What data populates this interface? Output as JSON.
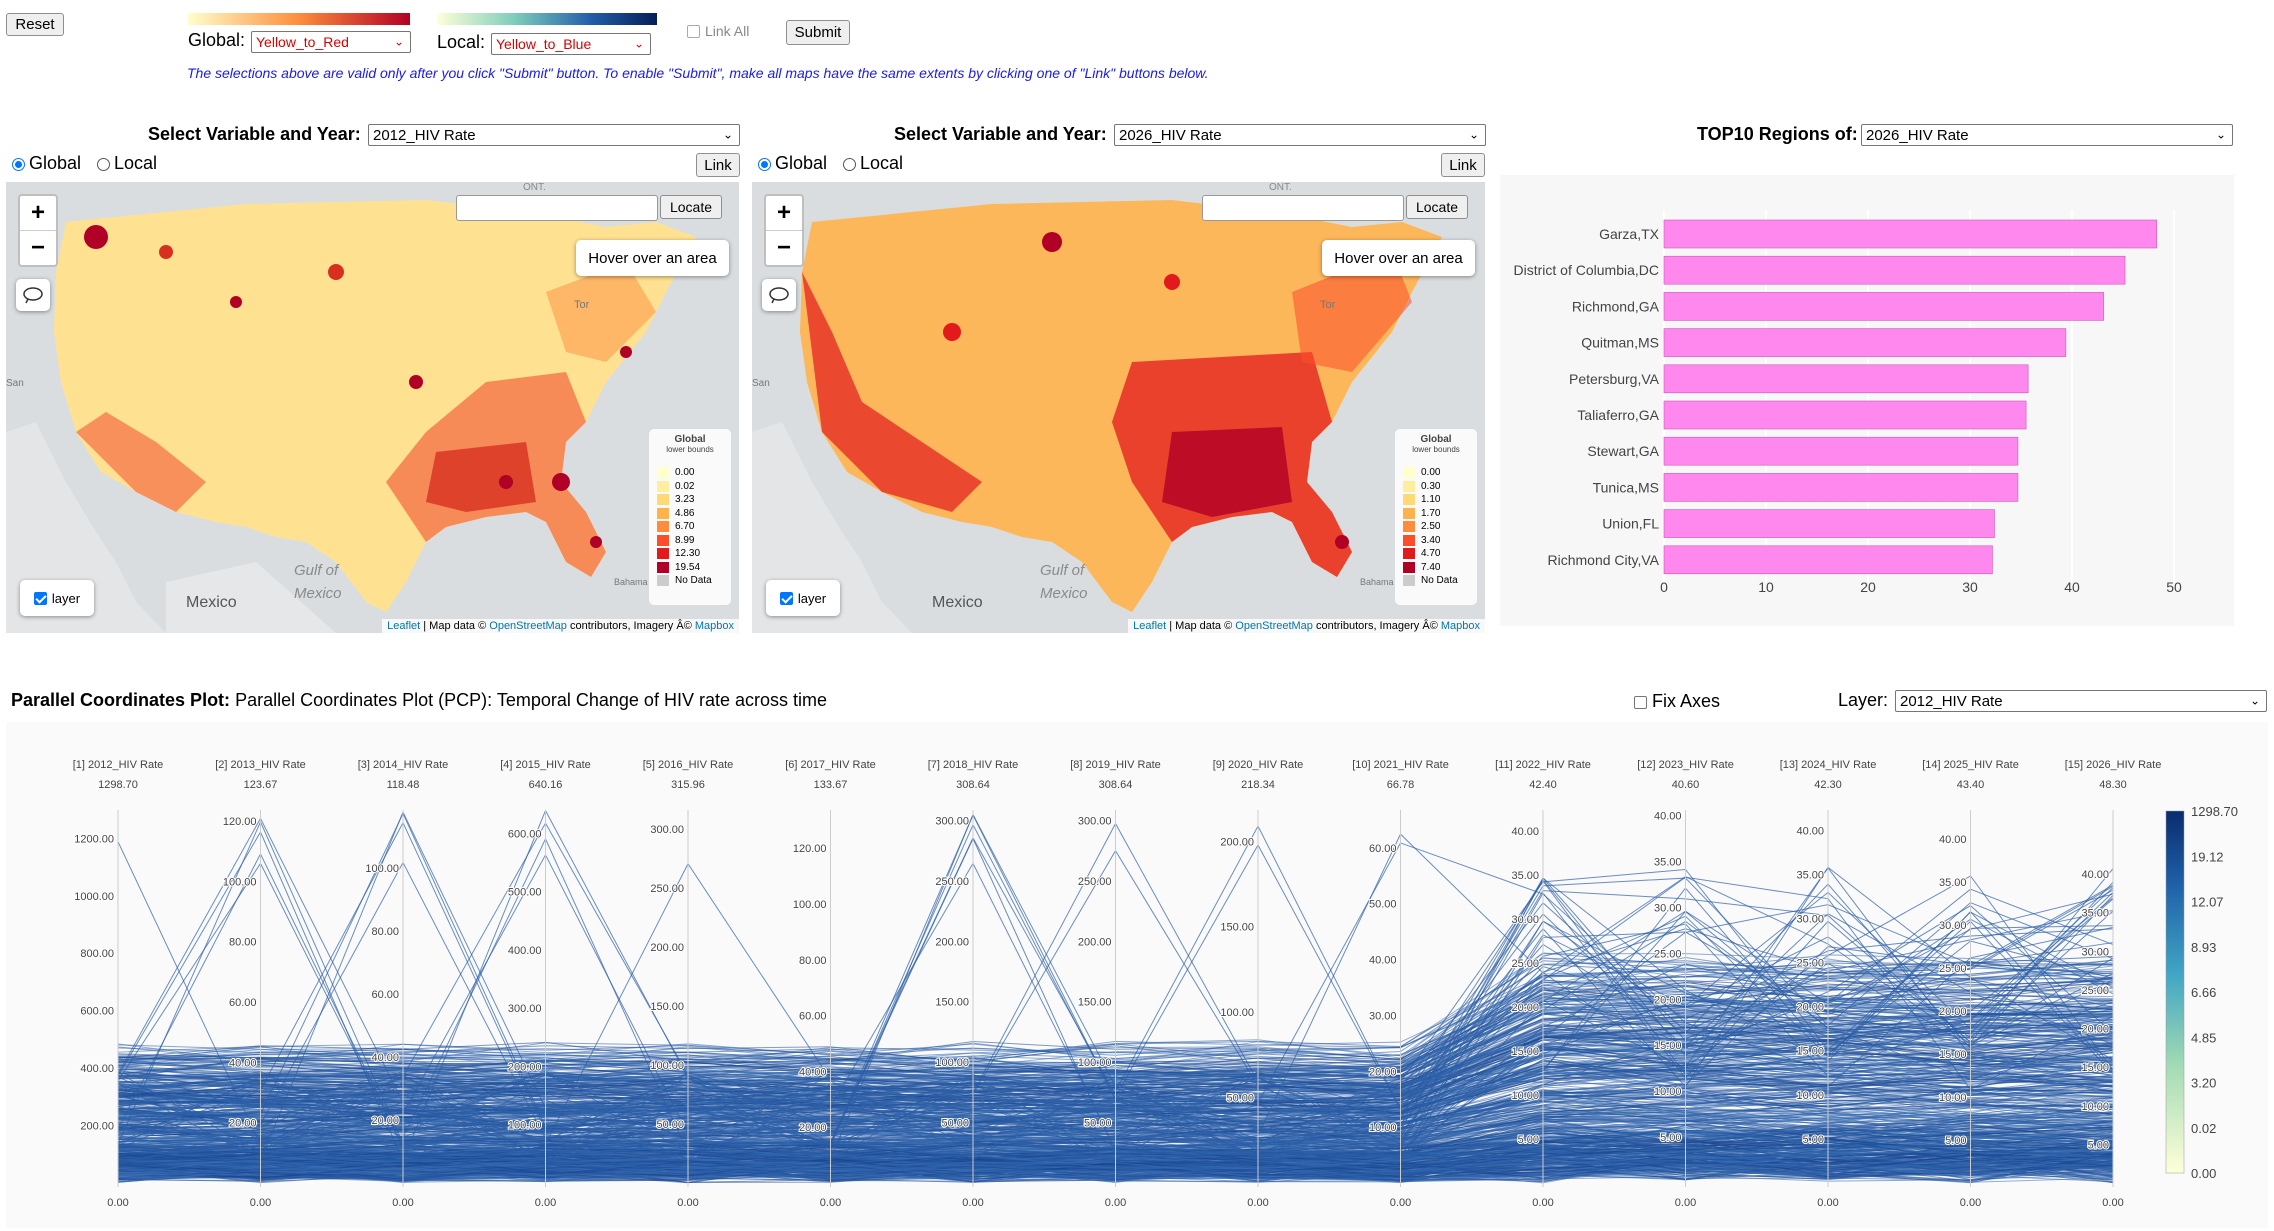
{
  "toolbar": {
    "reset_label": "Reset",
    "global_label": "Global:",
    "global_scheme": "Yellow_to_Red",
    "local_label": "Local:",
    "local_scheme": "Yellow_to_Blue",
    "link_all_label": "Link All",
    "submit_label": "Submit",
    "note": "The selections above are valid only after you click \"Submit\" button. To enable \"Submit\", make all maps have the same extents by clicking one of \"Link\" buttons below."
  },
  "maps": [
    {
      "select_label": "Select Variable and Year:",
      "selected": "2012_HIV Rate",
      "global_label": "Global",
      "local_label": "Local",
      "link_label": "Link",
      "locate_label": "Locate",
      "hover_text": "Hover over an area",
      "layer_label": "layer",
      "legend_title": "Global",
      "legend_subtitle": "lower bounds",
      "legend_values": [
        "0.00",
        "0.02",
        "3.23",
        "4.86",
        "6.70",
        "8.99",
        "12.30",
        "19.54",
        "No Data"
      ],
      "labels": {
        "mexico": "Mexico",
        "gulf1": "Gulf of",
        "gulf2": "Mexico",
        "ont": "ONT.",
        "tor": "Tor",
        "san": "San",
        "bahamas": "Bahama"
      }
    },
    {
      "select_label": "Select Variable and Year:",
      "selected": "2026_HIV Rate",
      "global_label": "Global",
      "local_label": "Local",
      "link_label": "Link",
      "locate_label": "Locate",
      "hover_text": "Hover over an area",
      "layer_label": "layer",
      "legend_title": "Global",
      "legend_subtitle": "lower bounds",
      "legend_values": [
        "0.00",
        "0.30",
        "1.10",
        "1.70",
        "2.50",
        "3.40",
        "4.70",
        "7.40",
        "No Data"
      ],
      "labels": {
        "mexico": "Mexico",
        "gulf1": "Gulf of",
        "gulf2": "Mexico",
        "ont": "ONT.",
        "tor": "Tor",
        "san": "San",
        "bahamas": "Bahama"
      }
    }
  ],
  "attribution": {
    "leaflet": "Leaflet",
    "text1": " | Map data © ",
    "osm": "OpenStreetMap",
    "text2": " contributors, Imagery Â© ",
    "mapbox": "Mapbox"
  },
  "legend_colors": [
    "#ffffcc",
    "#ffeda0",
    "#fed976",
    "#feb24c",
    "#fd8d3c",
    "#fc4e2a",
    "#e31a1c",
    "#b10026",
    "#cccccc"
  ],
  "top10": {
    "title": "TOP10 Regions of:",
    "selected": "2026_HIV Rate",
    "bar_color": "#ff88ee"
  },
  "chart_data": [
    {
      "type": "bar",
      "orientation": "horizontal",
      "categories": [
        "Garza,TX",
        "District of Columbia,DC",
        "Richmond,GA",
        "Quitman,MS",
        "Petersburg,VA",
        "Taliaferro,GA",
        "Stewart,GA",
        "Tunica,MS",
        "Union,FL",
        "Richmond City,VA"
      ],
      "values": [
        48.3,
        45.2,
        43.1,
        39.4,
        35.7,
        35.5,
        34.7,
        34.7,
        32.4,
        32.2
      ],
      "xlim": [
        0,
        50
      ],
      "xticks": [
        "0",
        "10",
        "20",
        "30",
        "40",
        "50"
      ]
    },
    {
      "type": "parallel_coordinates",
      "axes": [
        {
          "name": "[1] 2012_HIV Rate",
          "max": "1298.70",
          "ticks": [
            "0.00",
            "200.00",
            "400.00",
            "600.00",
            "800.00",
            "1000.00",
            "1200.00"
          ],
          "range": [
            0,
            1298.7
          ]
        },
        {
          "name": "[2] 2013_HIV Rate",
          "max": "123.67",
          "ticks": [
            "0.00",
            "20.00",
            "40.00",
            "60.00",
            "80.00",
            "100.00",
            "120.00"
          ],
          "range": [
            0,
            123.67
          ]
        },
        {
          "name": "[3] 2014_HIV Rate",
          "max": "118.48",
          "ticks": [
            "0.00",
            "20.00",
            "40.00",
            "60.00",
            "80.00",
            "100.00"
          ],
          "range": [
            0,
            118.48
          ]
        },
        {
          "name": "[4] 2015_HIV Rate",
          "max": "640.16",
          "ticks": [
            "0.00",
            "100.00",
            "200.00",
            "300.00",
            "400.00",
            "500.00",
            "600.00"
          ],
          "range": [
            0,
            640.16
          ]
        },
        {
          "name": "[5] 2016_HIV Rate",
          "max": "315.96",
          "ticks": [
            "0.00",
            "50.00",
            "100.00",
            "150.00",
            "200.00",
            "250.00",
            "300.00"
          ],
          "range": [
            0,
            315.96
          ]
        },
        {
          "name": "[6] 2017_HIV Rate",
          "max": "133.67",
          "ticks": [
            "0.00",
            "20.00",
            "40.00",
            "60.00",
            "80.00",
            "100.00",
            "120.00"
          ],
          "range": [
            0,
            133.67
          ]
        },
        {
          "name": "[7] 2018_HIV Rate",
          "max": "308.64",
          "ticks": [
            "0.00",
            "50.00",
            "100.00",
            "150.00",
            "200.00",
            "250.00",
            "300.00"
          ],
          "range": [
            0,
            308.64
          ]
        },
        {
          "name": "[8] 2019_HIV Rate",
          "max": "308.64",
          "ticks": [
            "0.00",
            "50.00",
            "100.00",
            "150.00",
            "200.00",
            "250.00",
            "300.00"
          ],
          "range": [
            0,
            308.64
          ]
        },
        {
          "name": "[9] 2020_HIV Rate",
          "max": "218.34",
          "ticks": [
            "0.00",
            "50.00",
            "100.00",
            "150.00",
            "200.00"
          ],
          "range": [
            0,
            218.34
          ]
        },
        {
          "name": "[10] 2021_HIV Rate",
          "max": "66.78",
          "ticks": [
            "0.00",
            "10.00",
            "20.00",
            "30.00",
            "40.00",
            "50.00",
            "60.00"
          ],
          "range": [
            0,
            66.78
          ]
        },
        {
          "name": "[11] 2022_HIV Rate",
          "max": "42.40",
          "ticks": [
            "0.00",
            "5.00",
            "10.00",
            "15.00",
            "20.00",
            "25.00",
            "30.00",
            "35.00",
            "40.00"
          ],
          "range": [
            0,
            42.4
          ]
        },
        {
          "name": "[12] 2023_HIV Rate",
          "max": "40.60",
          "ticks": [
            "0.00",
            "5.00",
            "10.00",
            "15.00",
            "20.00",
            "25.00",
            "30.00",
            "35.00",
            "40.00"
          ],
          "range": [
            0,
            40.6
          ]
        },
        {
          "name": "[13] 2024_HIV Rate",
          "max": "42.30",
          "ticks": [
            "0.00",
            "5.00",
            "10.00",
            "15.00",
            "20.00",
            "25.00",
            "30.00",
            "35.00",
            "40.00"
          ],
          "range": [
            0,
            42.3
          ]
        },
        {
          "name": "[14] 2025_HIV Rate",
          "max": "43.40",
          "ticks": [
            "0.00",
            "5.00",
            "10.00",
            "15.00",
            "20.00",
            "25.00",
            "30.00",
            "35.00",
            "40.00"
          ],
          "range": [
            0,
            43.4
          ]
        },
        {
          "name": "[15] 2026_HIV Rate",
          "max": "48.30",
          "ticks": [
            "0.00",
            "5.00",
            "10.00",
            "15.00",
            "20.00",
            "25.00",
            "30.00",
            "35.00",
            "40.00"
          ],
          "range": [
            0,
            48.3
          ]
        }
      ],
      "colorbar_ticks": [
        "1298.70",
        "19.12",
        "12.07",
        "8.93",
        "6.66",
        "4.85",
        "3.20",
        "0.02",
        "0.00"
      ]
    }
  ],
  "pcp": {
    "title_bold": "Parallel Coordinates Plot:",
    "title": " Parallel Coordinates Plot (PCP): Temporal Change of HIV rate across time",
    "fix_axes_label": "Fix Axes",
    "layer_label": "Layer:",
    "layer_selected": "2012_HIV Rate"
  }
}
